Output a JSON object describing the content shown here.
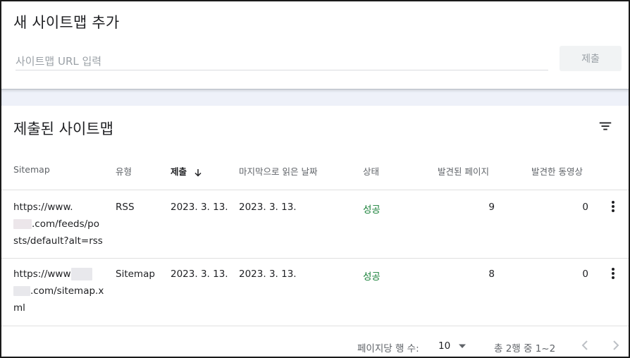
{
  "add_sitemap": {
    "title": "새 사이트맵 추가",
    "input_placeholder": "사이트맵 URL 입력",
    "input_value": "",
    "submit_label": "제출"
  },
  "submitted": {
    "title": "제출된 사이트맵",
    "columns": {
      "sitemap": "Sitemap",
      "type": "유형",
      "submitted": "제출",
      "last_read": "마지막으로 읽은 날짜",
      "status": "상태",
      "pages": "발견된 페이지",
      "videos": "발견한 동영상"
    },
    "rows": [
      {
        "url_line1": "https://www.",
        "url_line2": ".com/feeds/po",
        "url_line3": "sts/default?alt=rss",
        "type": "RSS",
        "submitted": "2023. 3. 13.",
        "last_read": "2023. 3. 13.",
        "status": "성공",
        "pages": "9",
        "videos": "0"
      },
      {
        "url_line1": "https://www",
        "url_line2": ".com/sitemap.x",
        "url_line3": "ml",
        "type": "Sitemap",
        "submitted": "2023. 3. 13.",
        "last_read": "2023. 3. 13.",
        "status": "성공",
        "pages": "8",
        "videos": "0"
      }
    ],
    "footer": {
      "rows_per_page_label": "페이지당 행 수:",
      "rows_per_page_value": "10",
      "range_label": "총 2행 중 1~2"
    }
  },
  "icons": {
    "filter": "filter-icon",
    "sort": "arrow-down-icon",
    "more": "more-vert-icon",
    "dropdown": "caret-down-icon",
    "prev": "chevron-left-icon",
    "next": "chevron-right-icon"
  },
  "colors": {
    "success": "#188038",
    "muted": "#5f6368",
    "disabled_button_bg": "#f1f3f4"
  }
}
